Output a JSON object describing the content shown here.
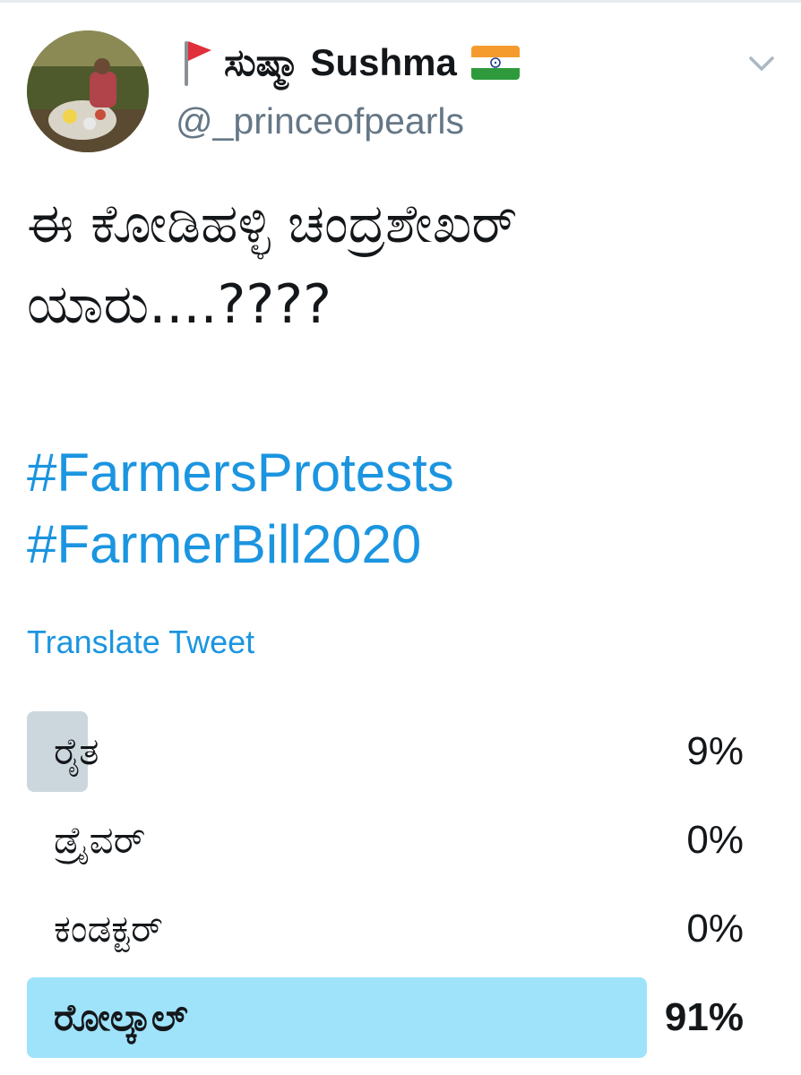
{
  "tweet": {
    "display_name": "ಸುಷ್ಮಾ Sushma",
    "handle": "@_princeofpearls",
    "text_lines": [
      "ಈ ಕೋಡಿಹಳ್ಳಿ ಚಂದ್ರಶೇಖರ್",
      "ಯಾರು....????"
    ],
    "hashtags": [
      "#FarmersProtests",
      "#FarmerBill2020"
    ],
    "translate_label": "Translate Tweet"
  },
  "icons": {
    "name_prefix": "red-flag-icon",
    "name_suffix": "india-flag-icon",
    "menu": "chevron-down-icon"
  },
  "colors": {
    "link": "#1b95e0",
    "secondary_text": "#657786",
    "poll_bar": "#ccd6dd",
    "poll_winner_bar": "#9fe3fb"
  },
  "poll": {
    "options": [
      {
        "label": "ರೈತ",
        "percent_text": "9%",
        "percent": 9,
        "winner": false
      },
      {
        "label": "ಡ್ರೈವರ್",
        "percent_text": "0%",
        "percent": 0,
        "winner": false
      },
      {
        "label": "ಕಂಡಕ್ಟರ್",
        "percent_text": "0%",
        "percent": 0,
        "winner": false
      },
      {
        "label": "ರೋಲ್ಕಾಲ್",
        "percent_text": "91%",
        "percent": 91,
        "winner": true
      }
    ]
  }
}
